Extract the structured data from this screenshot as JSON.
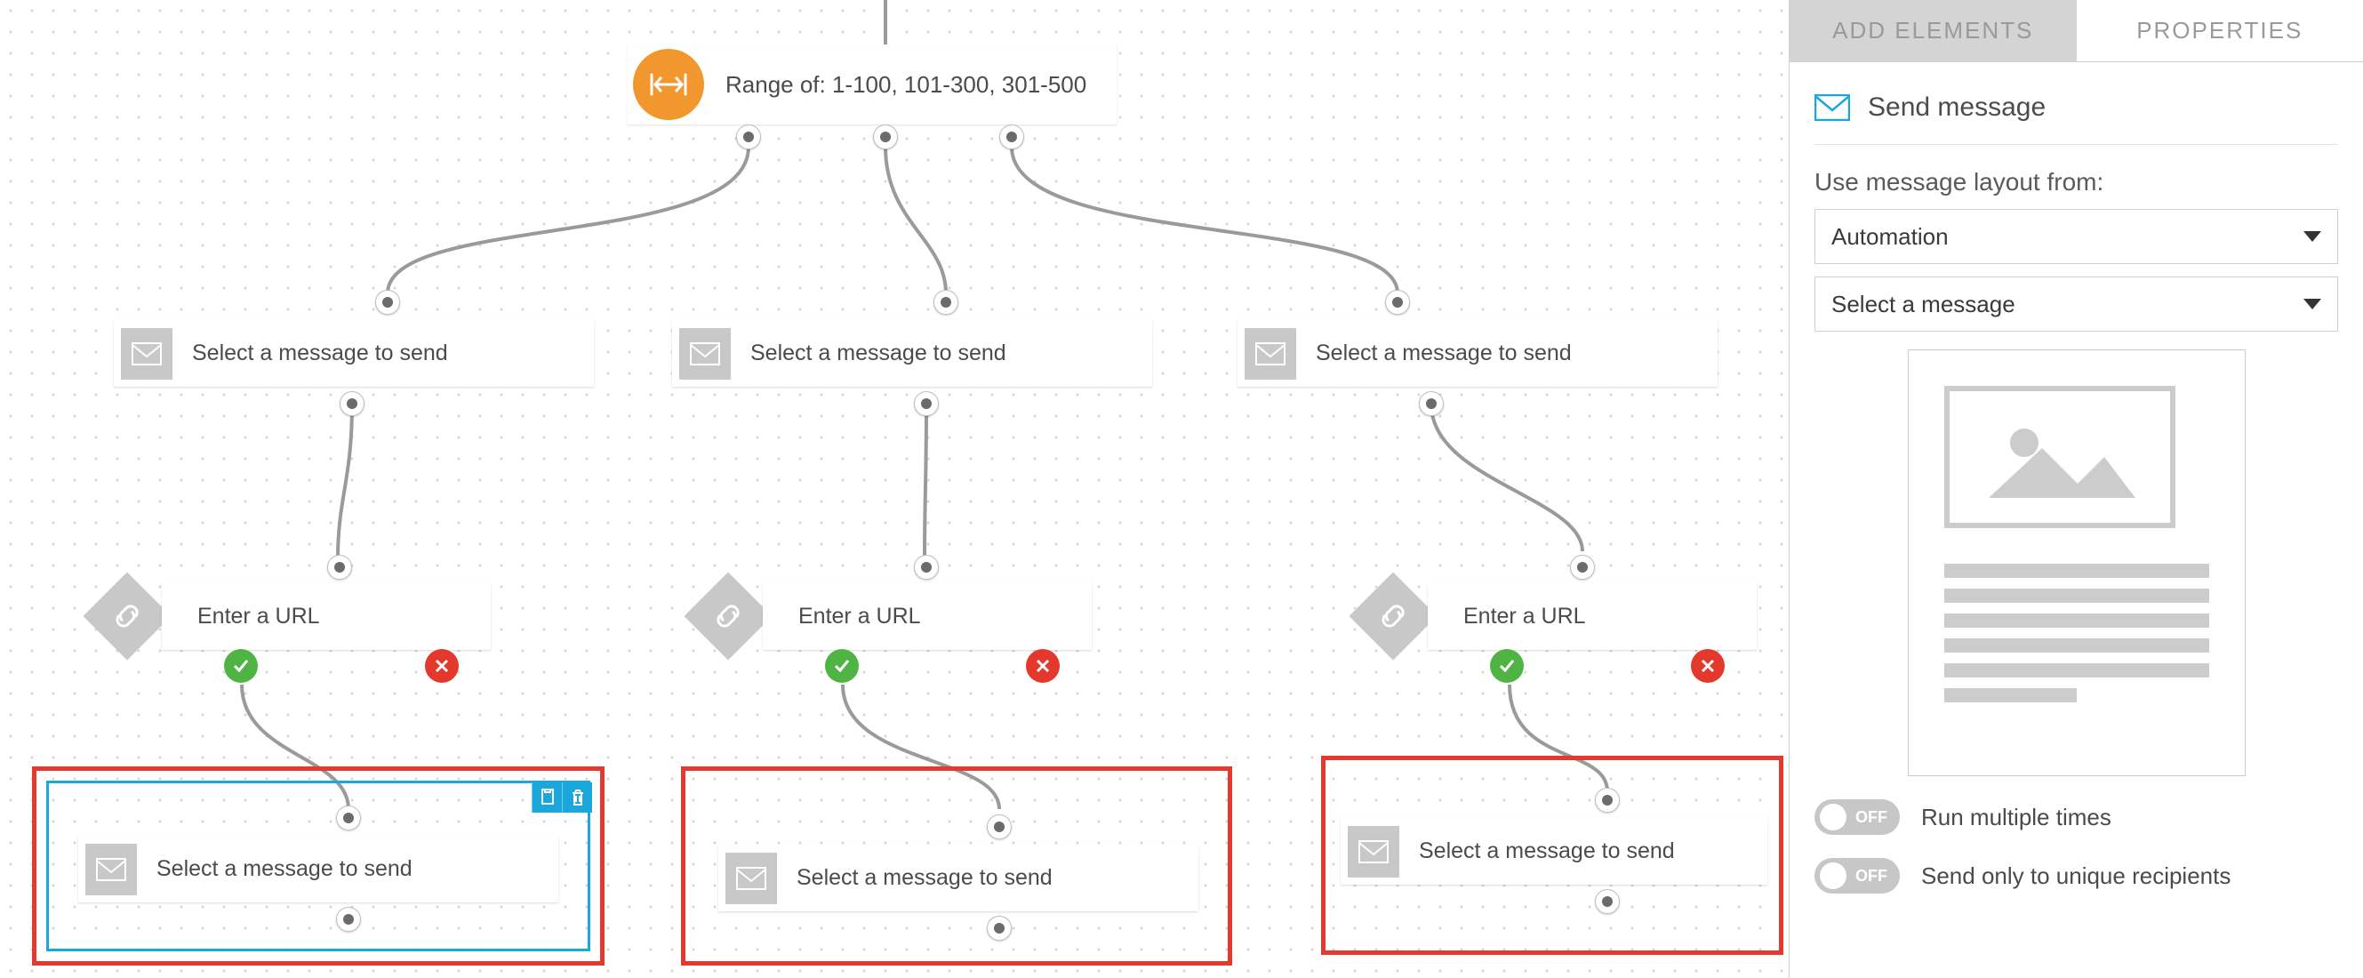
{
  "panel": {
    "tabs": {
      "add": "ADD ELEMENTS",
      "props": "PROPERTIES"
    },
    "title": "Send message",
    "layout_label": "Use message layout from:",
    "layout_value": "Automation",
    "message_value": "Select a message",
    "toggle_off": "OFF",
    "opt_multiple": "Run multiple times",
    "opt_unique": "Send only to unique recipients"
  },
  "canvas": {
    "range_label": "Range of: 1-100, 101-300, 301-500",
    "msg": "Select a message to send",
    "url": "Enter a URL"
  }
}
